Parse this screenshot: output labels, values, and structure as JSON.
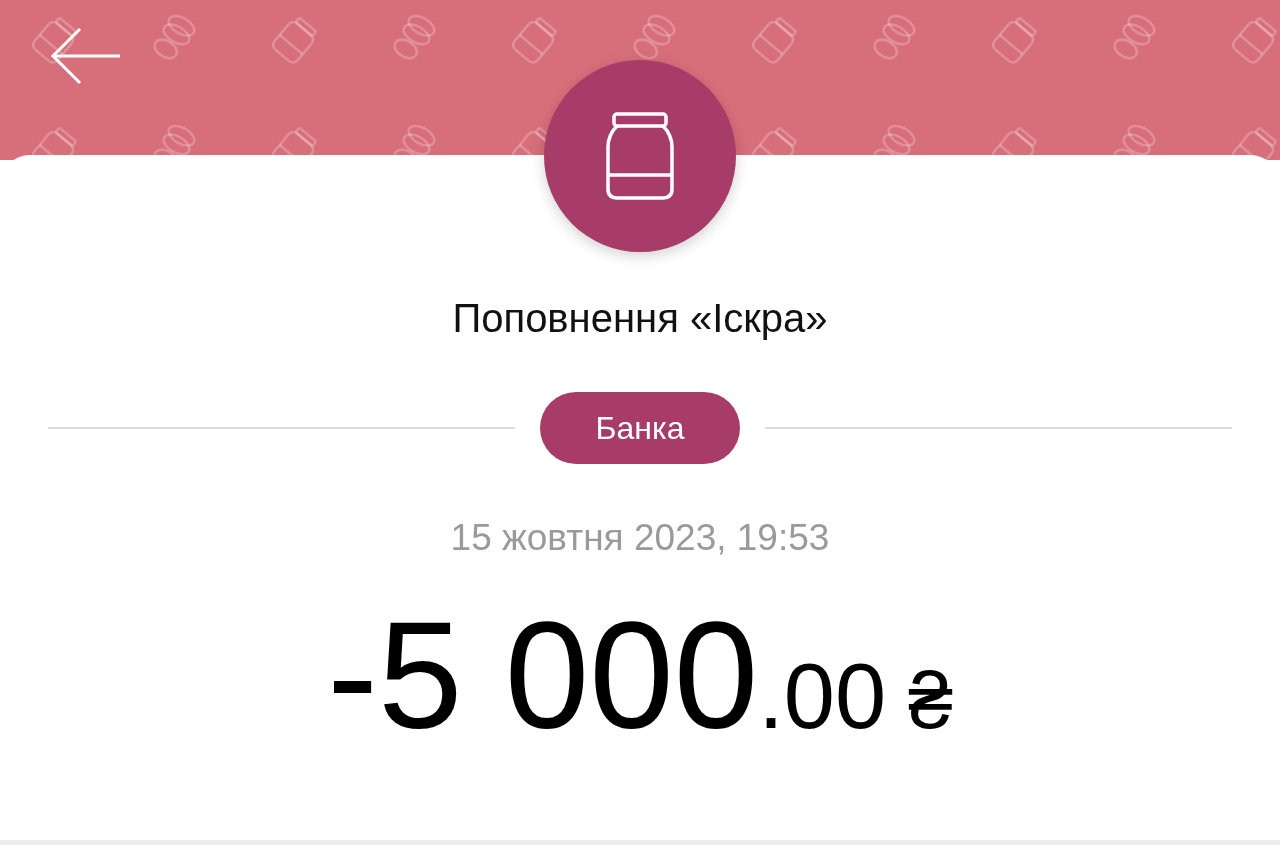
{
  "title": "Поповнення «Іскра»",
  "category": "Банка",
  "date": "15 жовтня 2023, 19:53",
  "amount": {
    "whole": "-5 000",
    "fraction": ".00",
    "currency": "₴"
  }
}
